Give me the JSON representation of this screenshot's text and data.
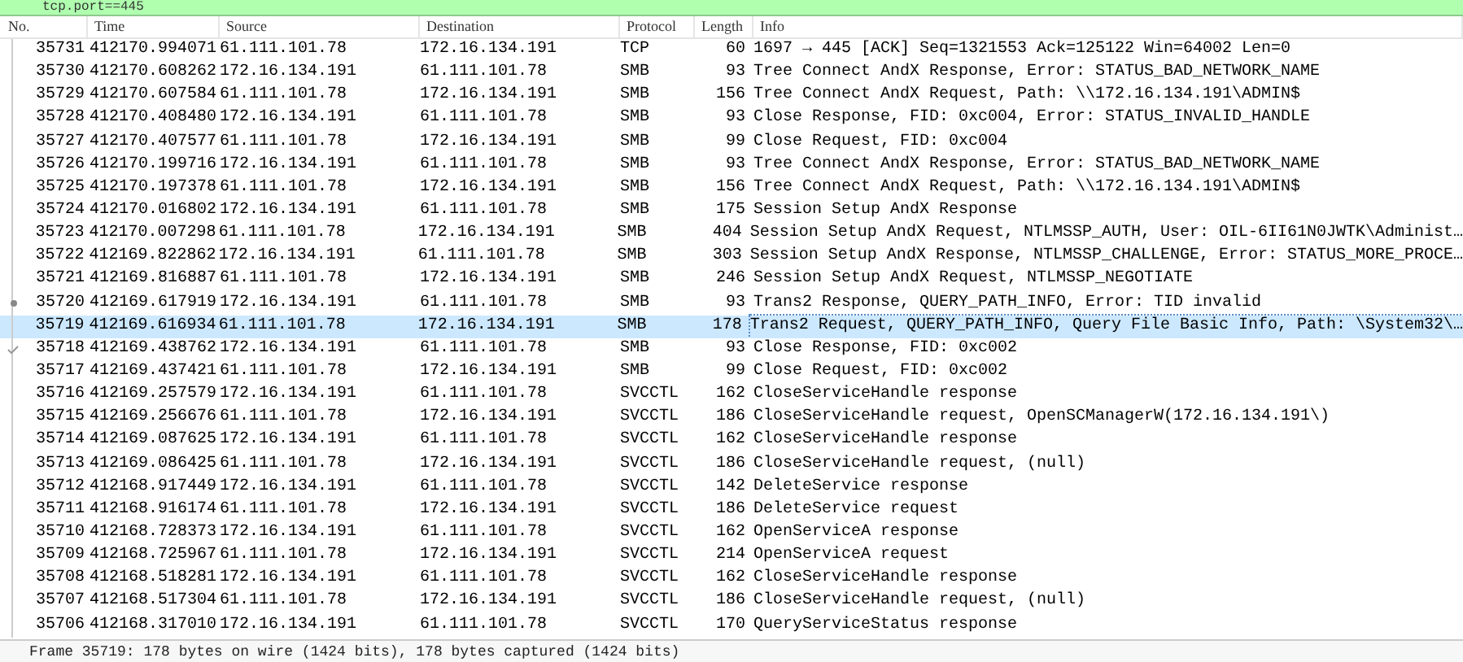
{
  "filter": {
    "value": "tcp.port==445"
  },
  "columns": [
    "No.",
    "Time",
    "Source",
    "Destination",
    "Protocol",
    "Length",
    "Info"
  ],
  "rows": [
    {
      "no": "35731",
      "time": "412170.994071",
      "src": "61.111.101.78",
      "dst": "172.16.134.191",
      "proto": "TCP",
      "len": "60",
      "info": "1697 → 445 [ACK] Seq=1321553 Ack=125122 Win=64002 Len=0",
      "selected": false
    },
    {
      "no": "35730",
      "time": "412170.608262",
      "src": "172.16.134.191",
      "dst": "61.111.101.78",
      "proto": "SMB",
      "len": "93",
      "info": "Tree Connect AndX Response, Error: STATUS_BAD_NETWORK_NAME",
      "selected": false
    },
    {
      "no": "35729",
      "time": "412170.607584",
      "src": "61.111.101.78",
      "dst": "172.16.134.191",
      "proto": "SMB",
      "len": "156",
      "info": "Tree Connect AndX Request, Path: \\\\172.16.134.191\\ADMIN$",
      "selected": false
    },
    {
      "no": "35728",
      "time": "412170.408480",
      "src": "172.16.134.191",
      "dst": "61.111.101.78",
      "proto": "SMB",
      "len": "93",
      "info": "Close Response, FID: 0xc004, Error: STATUS_INVALID_HANDLE",
      "selected": false
    },
    {
      "no": "35727",
      "time": "412170.407577",
      "src": "61.111.101.78",
      "dst": "172.16.134.191",
      "proto": "SMB",
      "len": "99",
      "info": "Close Request, FID: 0xc004",
      "selected": false
    },
    {
      "no": "35726",
      "time": "412170.199716",
      "src": "172.16.134.191",
      "dst": "61.111.101.78",
      "proto": "SMB",
      "len": "93",
      "info": "Tree Connect AndX Response, Error: STATUS_BAD_NETWORK_NAME",
      "selected": false
    },
    {
      "no": "35725",
      "time": "412170.197378",
      "src": "61.111.101.78",
      "dst": "172.16.134.191",
      "proto": "SMB",
      "len": "156",
      "info": "Tree Connect AndX Request, Path: \\\\172.16.134.191\\ADMIN$",
      "selected": false
    },
    {
      "no": "35724",
      "time": "412170.016802",
      "src": "172.16.134.191",
      "dst": "61.111.101.78",
      "proto": "SMB",
      "len": "175",
      "info": "Session Setup AndX Response",
      "selected": false
    },
    {
      "no": "35723",
      "time": "412170.007298",
      "src": "61.111.101.78",
      "dst": "172.16.134.191",
      "proto": "SMB",
      "len": "404",
      "info": "Session Setup AndX Request, NTLMSSP_AUTH, User: OIL-6II61N0JWTK\\Administ…",
      "selected": false
    },
    {
      "no": "35722",
      "time": "412169.822862",
      "src": "172.16.134.191",
      "dst": "61.111.101.78",
      "proto": "SMB",
      "len": "303",
      "info": "Session Setup AndX Response, NTLMSSP_CHALLENGE, Error: STATUS_MORE_PROCE…",
      "selected": false
    },
    {
      "no": "35721",
      "time": "412169.816887",
      "src": "61.111.101.78",
      "dst": "172.16.134.191",
      "proto": "SMB",
      "len": "246",
      "info": "Session Setup AndX Request, NTLMSSP_NEGOTIATE",
      "selected": false
    },
    {
      "no": "35720",
      "time": "412169.617919",
      "src": "172.16.134.191",
      "dst": "61.111.101.78",
      "proto": "SMB",
      "len": "93",
      "info": "Trans2 Response, QUERY_PATH_INFO, Error: TID invalid",
      "selected": false,
      "kind": "related"
    },
    {
      "no": "35719",
      "time": "412169.616934",
      "src": "61.111.101.78",
      "dst": "172.16.134.191",
      "proto": "SMB",
      "len": "178",
      "info": "Trans2 Request, QUERY_PATH_INFO, Query File Basic Info, Path: \\System32\\…",
      "selected": true
    },
    {
      "no": "35718",
      "time": "412169.438762",
      "src": "172.16.134.191",
      "dst": "61.111.101.78",
      "proto": "SMB",
      "len": "93",
      "info": "Close Response, FID: 0xc002",
      "selected": false,
      "kind": "ack"
    },
    {
      "no": "35717",
      "time": "412169.437421",
      "src": "61.111.101.78",
      "dst": "172.16.134.191",
      "proto": "SMB",
      "len": "99",
      "info": "Close Request, FID: 0xc002",
      "selected": false
    },
    {
      "no": "35716",
      "time": "412169.257579",
      "src": "172.16.134.191",
      "dst": "61.111.101.78",
      "proto": "SVCCTL",
      "len": "162",
      "info": "CloseServiceHandle response",
      "selected": false
    },
    {
      "no": "35715",
      "time": "412169.256676",
      "src": "61.111.101.78",
      "dst": "172.16.134.191",
      "proto": "SVCCTL",
      "len": "186",
      "info": "CloseServiceHandle request, OpenSCManagerW(172.16.134.191\\)",
      "selected": false
    },
    {
      "no": "35714",
      "time": "412169.087625",
      "src": "172.16.134.191",
      "dst": "61.111.101.78",
      "proto": "SVCCTL",
      "len": "162",
      "info": "CloseServiceHandle response",
      "selected": false
    },
    {
      "no": "35713",
      "time": "412169.086425",
      "src": "61.111.101.78",
      "dst": "172.16.134.191",
      "proto": "SVCCTL",
      "len": "186",
      "info": "CloseServiceHandle request, (null)",
      "selected": false
    },
    {
      "no": "35712",
      "time": "412168.917449",
      "src": "172.16.134.191",
      "dst": "61.111.101.78",
      "proto": "SVCCTL",
      "len": "142",
      "info": "DeleteService response",
      "selected": false
    },
    {
      "no": "35711",
      "time": "412168.916174",
      "src": "61.111.101.78",
      "dst": "172.16.134.191",
      "proto": "SVCCTL",
      "len": "186",
      "info": "DeleteService request",
      "selected": false
    },
    {
      "no": "35710",
      "time": "412168.728373",
      "src": "172.16.134.191",
      "dst": "61.111.101.78",
      "proto": "SVCCTL",
      "len": "162",
      "info": "OpenServiceA response",
      "selected": false
    },
    {
      "no": "35709",
      "time": "412168.725967",
      "src": "61.111.101.78",
      "dst": "172.16.134.191",
      "proto": "SVCCTL",
      "len": "214",
      "info": "OpenServiceA request",
      "selected": false
    },
    {
      "no": "35708",
      "time": "412168.518281",
      "src": "172.16.134.191",
      "dst": "61.111.101.78",
      "proto": "SVCCTL",
      "len": "162",
      "info": "CloseServiceHandle response",
      "selected": false
    },
    {
      "no": "35707",
      "time": "412168.517304",
      "src": "61.111.101.78",
      "dst": "172.16.134.191",
      "proto": "SVCCTL",
      "len": "186",
      "info": "CloseServiceHandle request, (null)",
      "selected": false
    },
    {
      "no": "35706",
      "time": "412168.317010",
      "src": "172.16.134.191",
      "dst": "61.111.101.78",
      "proto": "SVCCTL",
      "len": "170",
      "info": "QueryServiceStatus response",
      "selected": false
    }
  ],
  "status": {
    "text": "Frame 35719: 178 bytes on wire (1424 bits), 178 bytes captured (1424 bits)"
  }
}
